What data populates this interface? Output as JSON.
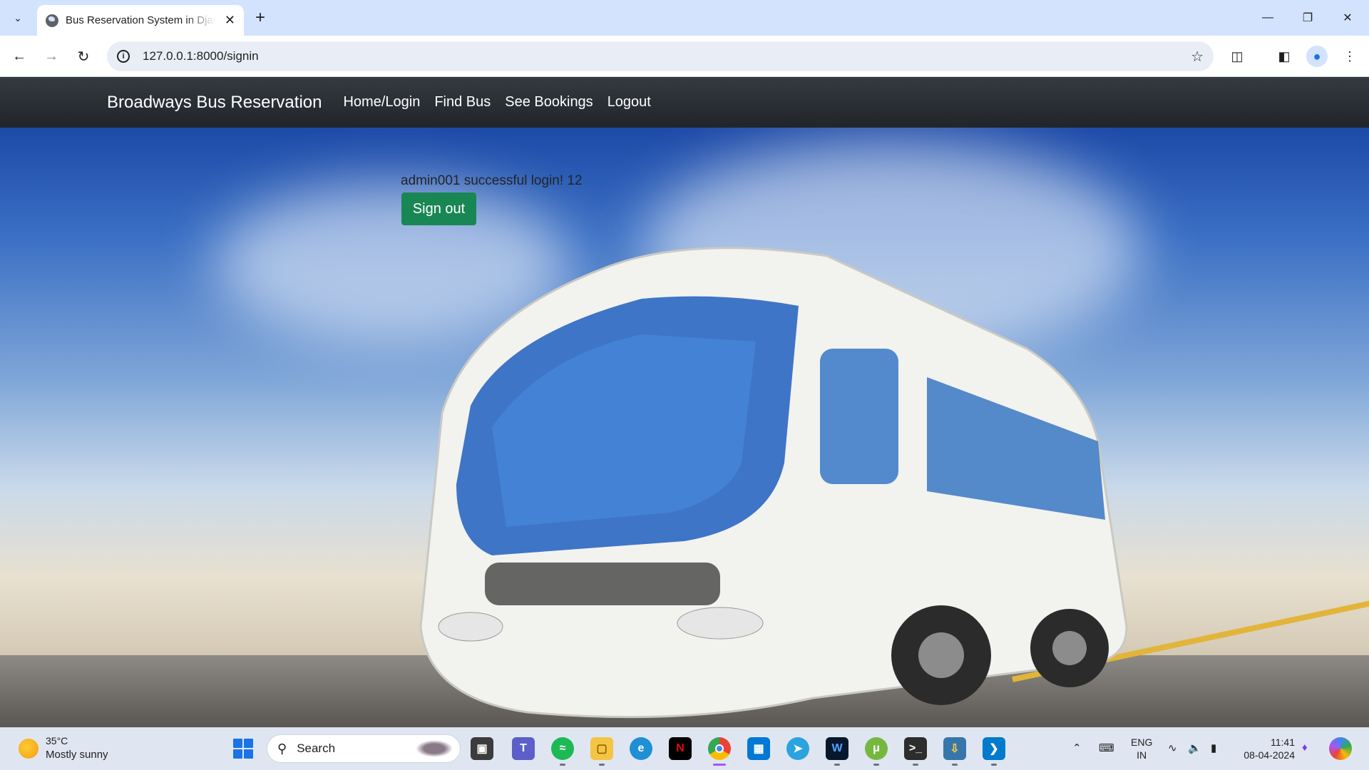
{
  "browser": {
    "tab_title": "Bus Reservation System in Django",
    "new_tab_icon": "+",
    "url": "127.0.0.1:8000/signin"
  },
  "site": {
    "brand": "Broadways Bus Reservation",
    "nav": [
      "Home/Login",
      "Find Bus",
      "See Bookings",
      "Logout"
    ],
    "message": "admin001 successful login! 12",
    "signout_label": "Sign out",
    "signout_color": "#198754"
  },
  "taskbar": {
    "weather_temp": "35°C",
    "weather_desc": "Mostly sunny",
    "search_placeholder": "Search",
    "apps": [
      "task-view-icon",
      "teams-icon",
      "spotify-icon",
      "file-explorer-icon",
      "edge-icon",
      "netflix-icon",
      "chrome-icon",
      "microsoft-store-icon",
      "telegram-icon",
      "webex-icon",
      "utorrent-icon",
      "terminal-icon",
      "python-installer-icon",
      "vscode-icon"
    ],
    "lang_line1": "ENG",
    "lang_line2": "IN",
    "time": "11:41",
    "date": "08-04-2024"
  }
}
